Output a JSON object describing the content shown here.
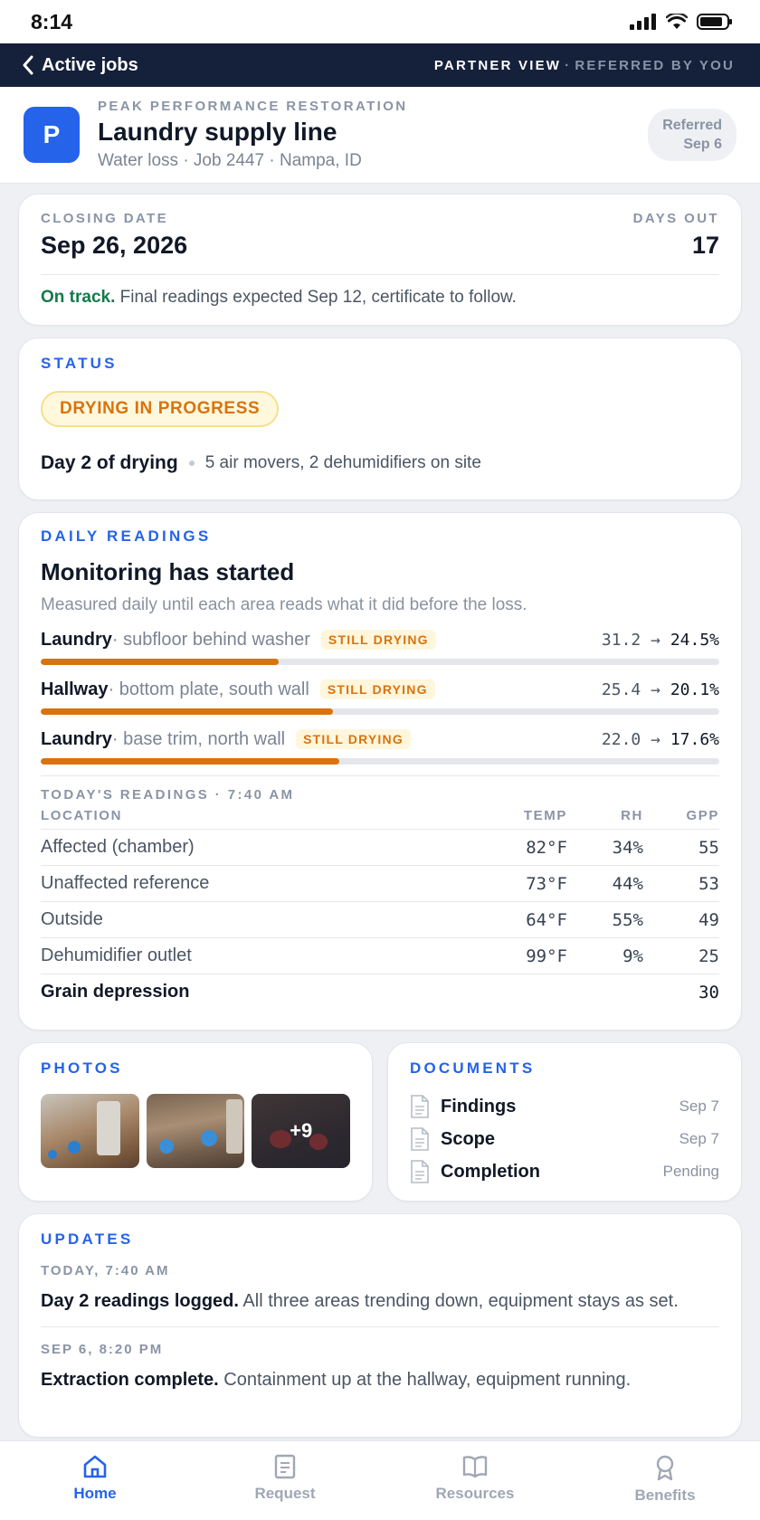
{
  "status_bar": {
    "time": "8:14"
  },
  "nav": {
    "back_label": "Active jobs",
    "view_label": "PARTNER VIEW",
    "separator": "·",
    "referred_label": "REFERRED BY YOU"
  },
  "job": {
    "logo_letter": "P",
    "company": "PEAK PERFORMANCE RESTORATION",
    "title": "Laundry supply line",
    "subtitle": "Water loss · Job 2447 · Nampa, ID",
    "referred_line1": "Referred",
    "referred_line2": "Sep 6"
  },
  "closing": {
    "label": "CLOSING DATE",
    "date": "Sep 26, 2026",
    "days_label": "DAYS OUT",
    "days": "17",
    "note_strong": "On track.",
    "note": " Final readings expected Sep 12, certificate to follow."
  },
  "status": {
    "label": "STATUS",
    "badge": "DRYING IN PROGRESS",
    "day": "Day 2 of drying",
    "equipment": "5 air movers, 2 dehumidifiers on site"
  },
  "readings": {
    "label": "DAILY READINGS",
    "heading": "Monitoring has started",
    "description": "Measured daily until each area reads what it did before the loss.",
    "areas": [
      {
        "room": "Laundry",
        "detail": " · subfloor behind washer",
        "tag": "STILL DRYING",
        "from": "31.2",
        "arrow": "→",
        "to": "24.5%",
        "progress": 0.35
      },
      {
        "room": "Hallway",
        "detail": " · bottom plate, south wall",
        "tag": "STILL DRYING",
        "from": "25.4",
        "arrow": "→",
        "to": "20.1%",
        "progress": 0.43
      },
      {
        "room": "Laundry",
        "detail": " · base trim, north wall",
        "tag": "STILL DRYING",
        "from": "22.0",
        "arrow": "→",
        "to": "17.6%",
        "progress": 0.44
      }
    ],
    "today_label": "TODAY'S READINGS · 7:40 AM",
    "columns": [
      "LOCATION",
      "TEMP",
      "RH",
      "GPP"
    ],
    "rows": [
      {
        "location": "Affected (chamber)",
        "temp": "82°F",
        "rh": "34%",
        "gpp": "55"
      },
      {
        "location": "Unaffected reference",
        "temp": "73°F",
        "rh": "44%",
        "gpp": "53"
      },
      {
        "location": "Outside",
        "temp": "64°F",
        "rh": "55%",
        "gpp": "49"
      },
      {
        "location": "Dehumidifier outlet",
        "temp": "99°F",
        "rh": "9%",
        "gpp": "25"
      },
      {
        "location": "Grain depression",
        "temp": "",
        "rh": "",
        "gpp": "30"
      }
    ]
  },
  "photos": {
    "label": "PHOTOS",
    "more": "+9"
  },
  "documents": {
    "label": "DOCUMENTS",
    "items": [
      {
        "name": "Findings",
        "date": "Sep 7"
      },
      {
        "name": "Scope",
        "date": "Sep 7"
      },
      {
        "name": "Completion",
        "date": "Pending"
      }
    ]
  },
  "updates": {
    "label": "UPDATES",
    "items": [
      {
        "when": "TODAY, 7:40 AM",
        "title": "Day 2 readings logged.",
        "text": " All three areas trending down, equipment stays as set."
      },
      {
        "when": "SEP 6, 8:20 PM",
        "title": "Extraction complete.",
        "text": " Containment up at the hallway, equipment running."
      }
    ]
  },
  "tabs": [
    {
      "label": "Home",
      "icon": "home-icon",
      "active": true
    },
    {
      "label": "Request",
      "icon": "document-icon",
      "active": false
    },
    {
      "label": "Resources",
      "icon": "book-icon",
      "active": false
    },
    {
      "label": "Benefits",
      "icon": "award-icon",
      "active": false
    }
  ],
  "colors": {
    "accent": "#2563eb",
    "nav_bg": "#15203a",
    "warning": "#d9730d",
    "success": "#16794c"
  }
}
